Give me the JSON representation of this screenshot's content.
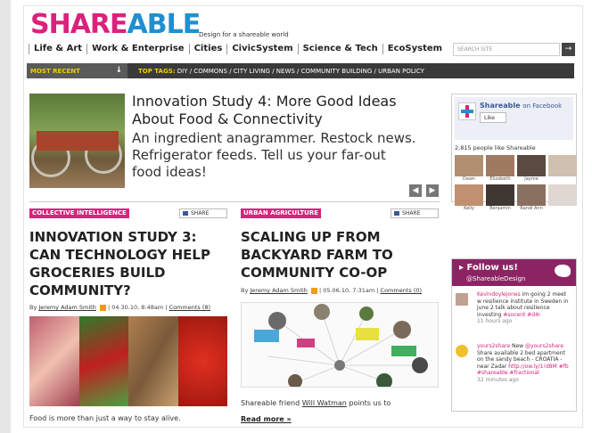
{
  "header": {
    "logo_part1": "SHARE",
    "logo_part2": "ABLE",
    "tagline": "Design for a shareable world",
    "nav": [
      "Life & Art",
      "Work & Enterprise",
      "Cities",
      "CivicSystem",
      "Science & Tech",
      "EcoSystem"
    ],
    "search_placeholder": "SEARCH SITE",
    "search_button": "→"
  },
  "topbar": {
    "most_recent": "MOST RECENT",
    "most_recent_arrow": "↓",
    "top_tags_label": "TOP TAGS:",
    "top_tags": "DIY  /  COMMONS  /  CITY LIVING  /  NEWS  /  COMMUNITY BUILDING  /  URBAN POLICY"
  },
  "featured": {
    "title": "Innovation Study 4: More Good Ideas About Food & Connectivity",
    "subtitle": "An ingredient anagrammer. Restock news. Refrigerator feeds. Tell us your far-out food ideas!",
    "prev": "◀",
    "next": "▶"
  },
  "article1": {
    "category": "COLLECTIVE INTELLIGENCE",
    "share": "SHARE",
    "title": "INNOVATION STUDY 3: CAN TECHNOLOGY HELP GROCERIES BUILD COMMUNITY?",
    "by": "By",
    "author": "Jeremy Adam Smith",
    "date": "04.30.10, 8:48am",
    "comments": "Comments (8)",
    "body": "Food is more than just a way to stay alive."
  },
  "article2": {
    "category": "URBAN AGRICULTURE",
    "share": "SHARE",
    "title": "SCALING UP FROM BACKYARD FARM TO COMMUNITY CO-OP",
    "by": "By",
    "author": "Jeremy Adam Smith",
    "date": "05.06.10, 7:31am",
    "comments": "Comments (0)",
    "body_pre": "Shareable friend ",
    "body_link": "Will Watman",
    "body_post": " points us to",
    "read_more": "Read more »"
  },
  "facebook": {
    "name": "Shareable",
    "on": "on Facebook",
    "like": "Like",
    "count": "2,815 people like Shareable",
    "fans": [
      "Dawn",
      "Elizabeth",
      "Jayme",
      "",
      "Kelly",
      "Benjamin",
      "Randi Ann",
      ""
    ]
  },
  "twitter": {
    "follow": "Follow us!",
    "handle": "@ShareableDesign",
    "tweets": [
      {
        "user": "Kevindoylejones",
        "text": "im going 2 meet w resilience institute in Sweden in june 2 talk about resilience investing",
        "tag": "#socent #d4r",
        "time": "11 hours ago"
      },
      {
        "user": "yours2share",
        "text": "New",
        "handle": "@yours2share",
        "text2": "Share available 2 bed apartment on the sandy beach - CROATIA - near Zadar",
        "link": "http://ow.ly/1!d8M #fb",
        "tag": "#shareable #fractional",
        "time": "32 minutes ago"
      }
    ]
  },
  "colors": {
    "brand_pink": "#d9227c",
    "brand_blue": "#1f8fcf",
    "bar": "#3a3a3a",
    "tag_yellow": "#f0d000",
    "twitter_purple": "#8c2464"
  }
}
